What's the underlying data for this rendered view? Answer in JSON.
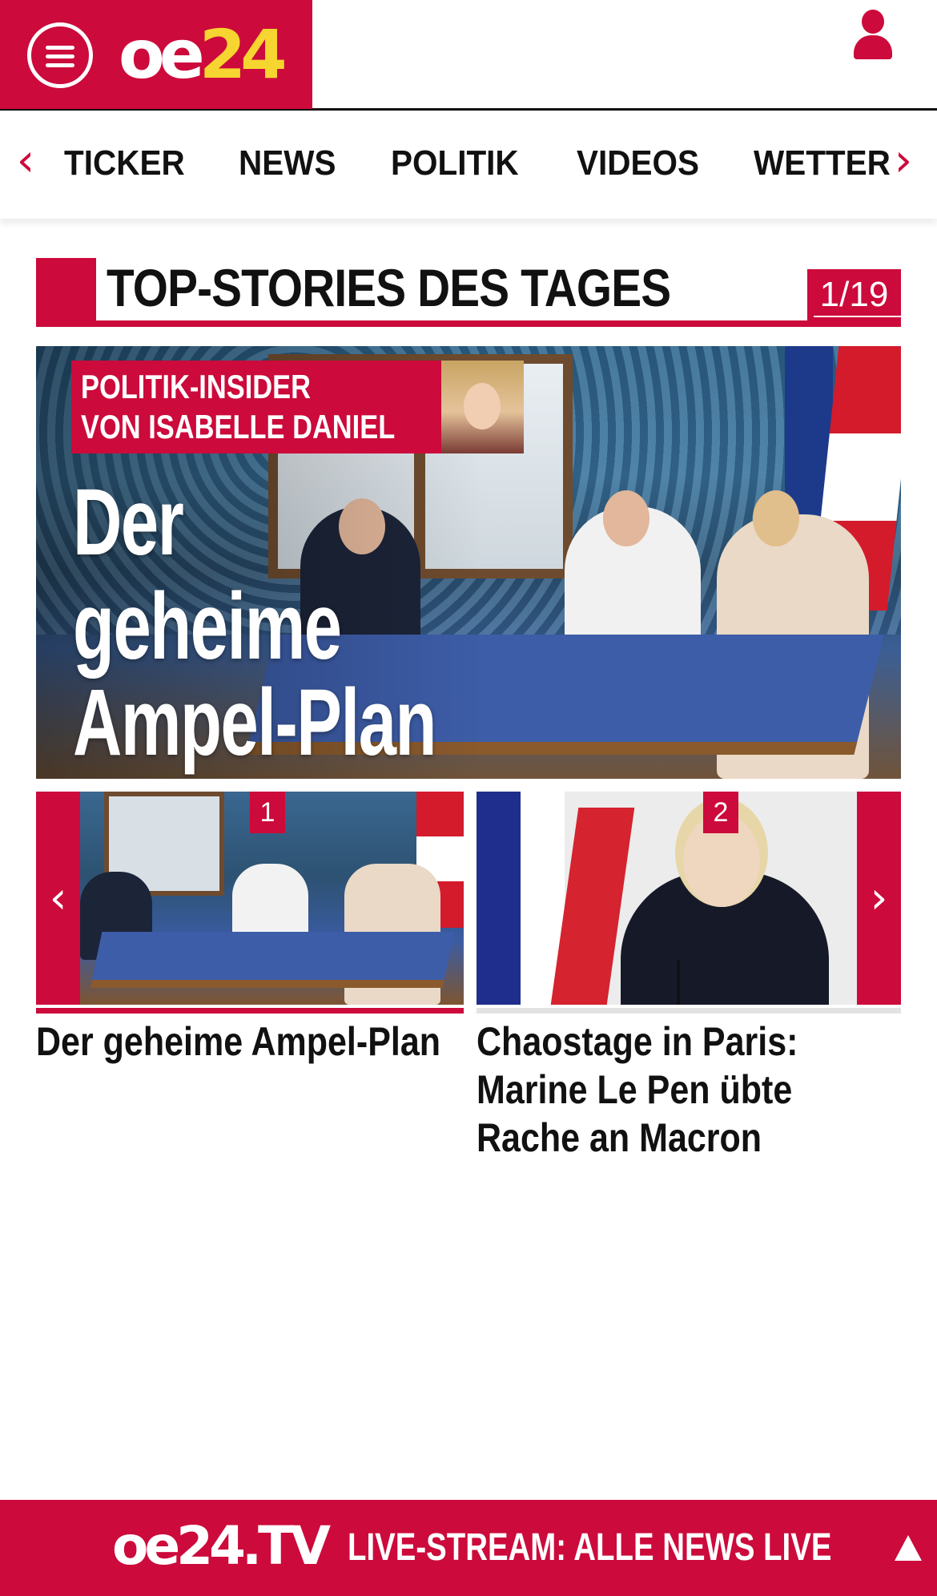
{
  "header": {
    "logo_oe": "oe",
    "logo_num": "24",
    "menu_icon": "hamburger-menu-icon",
    "user_icon": "user-icon",
    "brand_color": "#cc0a3b",
    "logo_accent": "#f6d531"
  },
  "nav": {
    "prev_icon": "chevron-left-icon",
    "next_icon": "chevron-right-icon",
    "items": [
      {
        "label": "TICKER"
      },
      {
        "label": "NEWS"
      },
      {
        "label": "POLITIK"
      },
      {
        "label": "VIDEOS"
      },
      {
        "label": "WETTER"
      }
    ]
  },
  "section": {
    "title": "TOP-STORIES DES TAGES",
    "counter": "1/19"
  },
  "hero": {
    "badge_line1": "POLITIK-INSIDER",
    "badge_line2": "VON ISABELLE DANIEL",
    "title_line1": "Der",
    "title_line2": "geheime",
    "title_line3": "Ampel-Plan"
  },
  "carousel": {
    "prev_label": "‹",
    "next_label": "›",
    "stories": [
      {
        "num": "1",
        "title": "Der geheime Ampel-Plan",
        "active": true
      },
      {
        "num": "2",
        "title": "Chaostage in Paris: Marine Le Pen übte Rache an Macron",
        "active": false
      }
    ]
  },
  "footer": {
    "logo": "oe24.TV",
    "text": "LIVE-STREAM:  ALLE NEWS LIVE",
    "up_icon": "arrow-up-icon"
  }
}
